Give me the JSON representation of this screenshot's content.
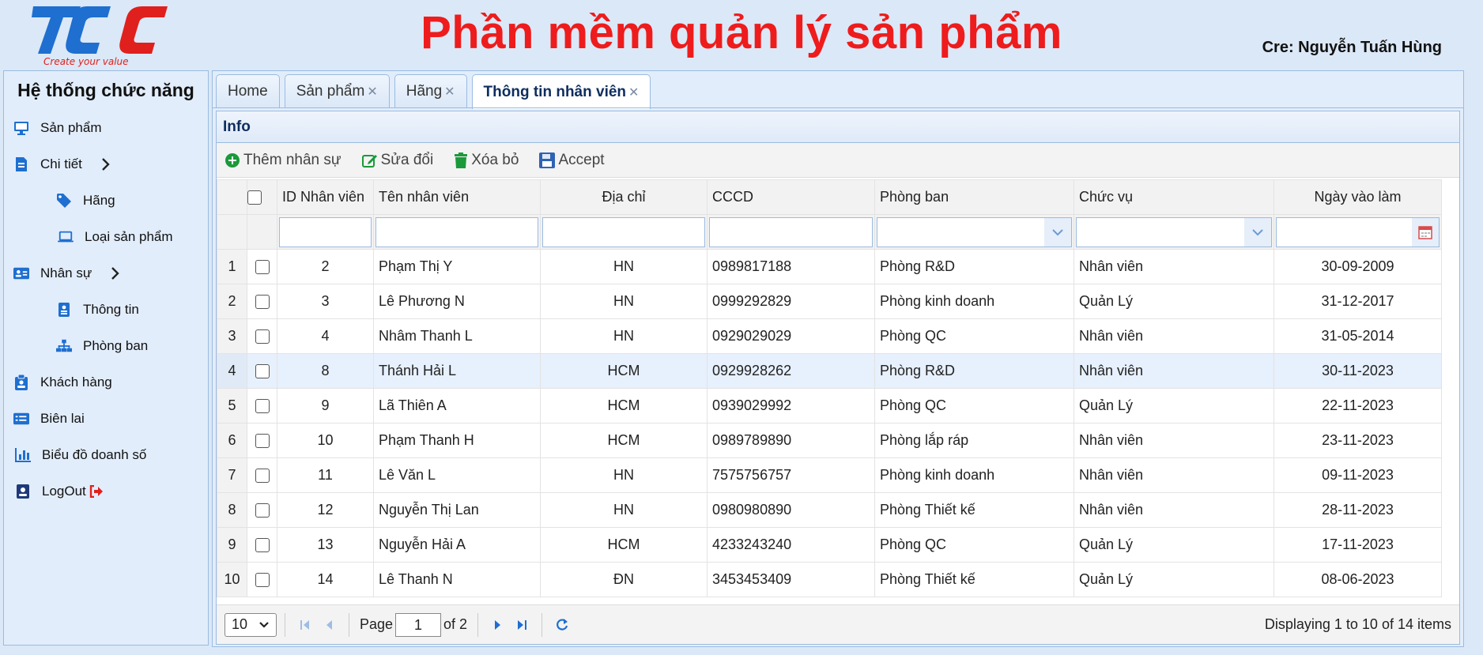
{
  "header": {
    "logo_text": "TCC",
    "logo_tagline": "Create your value",
    "title": "Phần mềm quản lý sản phẩm",
    "credit": "Cre: Nguyễn Tuấn Hùng"
  },
  "sidebar": {
    "title": "Hệ thống chức năng",
    "items": [
      {
        "label": "Sản phẩm",
        "icon": "monitor-icon"
      },
      {
        "label": "Chi tiết",
        "icon": "list-icon"
      },
      {
        "label": "Hãng",
        "icon": "tag-icon"
      },
      {
        "label": "Loại sản phẩm",
        "icon": "laptop-icon"
      },
      {
        "label": "Nhân sự",
        "icon": "id-card-icon"
      },
      {
        "label": "Thông tin",
        "icon": "badge-icon"
      },
      {
        "label": "Phòng ban",
        "icon": "sitemap-icon"
      },
      {
        "label": "Khách hàng",
        "icon": "clipboard-user-icon"
      },
      {
        "label": "Biên lai",
        "icon": "receipt-icon"
      },
      {
        "label": "Biểu đồ doanh số",
        "icon": "chart-icon"
      },
      {
        "label": "LogOut",
        "icon": "user-badge-icon"
      }
    ]
  },
  "tabs": [
    {
      "label": "Home"
    },
    {
      "label": "Sản phẩm"
    },
    {
      "label": "Hãng"
    },
    {
      "label": "Thông tin nhân viên"
    }
  ],
  "panel": {
    "title": "Info",
    "toolbar": {
      "add": "Thêm nhân sự",
      "edit": "Sửa đổi",
      "delete": "Xóa bỏ",
      "accept": "Accept"
    }
  },
  "grid": {
    "columns": [
      "ID Nhân viên",
      "Tên nhân viên",
      "Địa chỉ",
      "CCCD",
      "Phòng ban",
      "Chức vụ",
      "Ngày vào làm"
    ],
    "rows": [
      {
        "n": "1",
        "id": "2",
        "name": "Phạm Thị Y",
        "addr": "HN",
        "cccd": "0989817188",
        "dept": "Phòng R&D",
        "role": "Nhân viên",
        "date": "30-09-2009"
      },
      {
        "n": "2",
        "id": "3",
        "name": "Lê Phương N",
        "addr": "HN",
        "cccd": "0999292829",
        "dept": "Phòng kinh doanh",
        "role": "Quản Lý",
        "date": "31-12-2017"
      },
      {
        "n": "3",
        "id": "4",
        "name": "Nhâm Thanh L",
        "addr": "HN",
        "cccd": "0929029029",
        "dept": "Phòng QC",
        "role": "Nhân viên",
        "date": "31-05-2014"
      },
      {
        "n": "4",
        "id": "8",
        "name": "Thánh Hải L",
        "addr": "HCM",
        "cccd": "0929928262",
        "dept": "Phòng R&D",
        "role": "Nhân viên",
        "date": "30-11-2023"
      },
      {
        "n": "5",
        "id": "9",
        "name": "Lã Thiên A",
        "addr": "HCM",
        "cccd": "0939029992",
        "dept": "Phòng QC",
        "role": "Quản Lý",
        "date": "22-11-2023"
      },
      {
        "n": "6",
        "id": "10",
        "name": "Phạm Thanh H",
        "addr": "HCM",
        "cccd": "0989789890",
        "dept": "Phòng lắp ráp",
        "role": "Nhân viên",
        "date": "23-11-2023"
      },
      {
        "n": "7",
        "id": "11",
        "name": "Lê Văn L",
        "addr": "HN",
        "cccd": "7575756757",
        "dept": "Phòng kinh doanh",
        "role": "Nhân viên",
        "date": "09-11-2023"
      },
      {
        "n": "8",
        "id": "12",
        "name": "Nguyễn Thị Lan",
        "addr": "HN",
        "cccd": "0980980890",
        "dept": "Phòng Thiết kế",
        "role": "Nhân viên",
        "date": "28-11-2023"
      },
      {
        "n": "9",
        "id": "13",
        "name": "Nguyễn Hải A",
        "addr": "HCM",
        "cccd": "4233243240",
        "dept": "Phòng QC",
        "role": "Quản Lý",
        "date": "17-11-2023"
      },
      {
        "n": "10",
        "id": "14",
        "name": "Lê Thanh N",
        "addr": "ĐN",
        "cccd": "3453453409",
        "dept": "Phòng Thiết kế",
        "role": "Quản Lý",
        "date": "08-06-2023"
      }
    ]
  },
  "pager": {
    "page_size": "10",
    "page_label": "Page",
    "page_value": "1",
    "of_label": "of 2",
    "info": "Displaying 1 to 10 of 14 items"
  },
  "colors": {
    "title_red": "#ee1c1c",
    "accent_blue": "#1e6fd0",
    "panel_border": "#9bbbe0"
  }
}
